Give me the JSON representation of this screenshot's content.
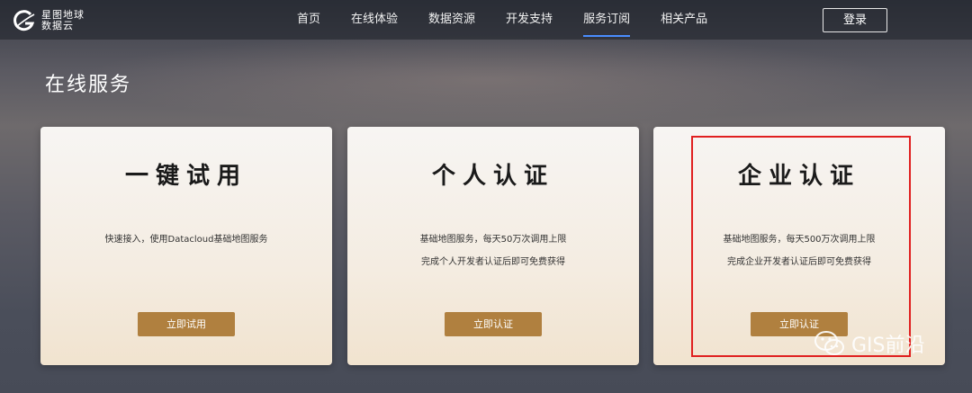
{
  "brand": {
    "line1": "星图地球",
    "line2": "数据云"
  },
  "nav": {
    "items": [
      "首页",
      "在线体验",
      "数据资源",
      "开发支持",
      "服务订阅",
      "相关产品"
    ],
    "active_index": 4
  },
  "login_label": "登录",
  "page_title": "在线服务",
  "cards": [
    {
      "title": "一键试用",
      "desc_lines": [
        "快速接入，使用Datacloud基础地图服务"
      ],
      "button": "立即试用"
    },
    {
      "title": "个人认证",
      "desc_lines": [
        "基础地图服务，每天50万次调用上限",
        "完成个人开发者认证后即可免费获得"
      ],
      "button": "立即认证"
    },
    {
      "title": "企业认证",
      "desc_lines": [
        "基础地图服务，每天500万次调用上限",
        "完成企业开发者认证后即可免费获得"
      ],
      "button": "立即认证"
    }
  ],
  "watermark": "GIS前沿",
  "colors": {
    "button_bg": "#b0803f",
    "highlight_border": "#e02020",
    "nav_active_underline": "#4a8dff"
  }
}
